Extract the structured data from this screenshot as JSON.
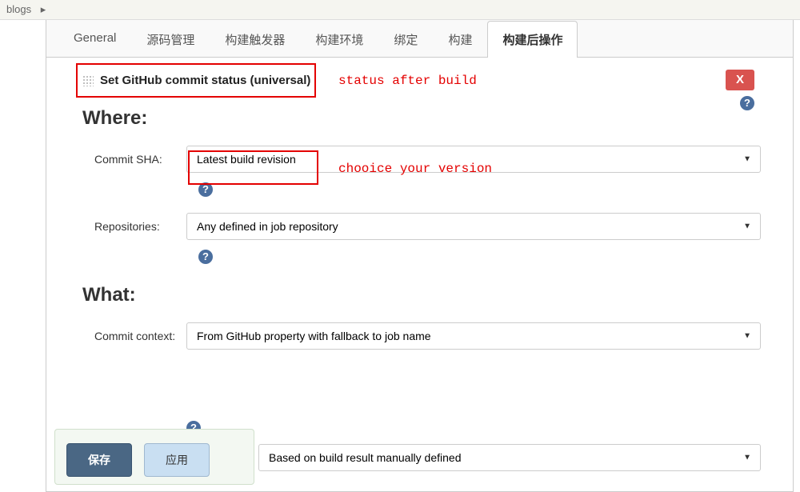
{
  "breadcrumb": {
    "item1": "blogs",
    "separator": "▸"
  },
  "tabs": [
    {
      "label": "General",
      "active": false
    },
    {
      "label": "源码管理",
      "active": false
    },
    {
      "label": "构建触发器",
      "active": false
    },
    {
      "label": "构建环境",
      "active": false
    },
    {
      "label": "绑定",
      "active": false
    },
    {
      "label": "构建",
      "active": false
    },
    {
      "label": "构建后操作",
      "active": true
    }
  ],
  "section": {
    "title": "Set GitHub commit status (universal)",
    "close_label": "X"
  },
  "annotations": {
    "status_after": "status after build",
    "choice_version": "chooice your version"
  },
  "where": {
    "heading": "Where:",
    "commit_sha_label": "Commit SHA:",
    "commit_sha_value": "Latest build revision",
    "repositories_label": "Repositories:",
    "repositories_value": "Any defined in job repository"
  },
  "what": {
    "heading": "What:",
    "commit_context_label": "Commit context:",
    "commit_context_value": "From GitHub property with fallback to job name",
    "status_result_value": "Based on build result manually defined"
  },
  "buttons": {
    "save": "保存",
    "apply": "应用"
  },
  "help_icon": "?"
}
